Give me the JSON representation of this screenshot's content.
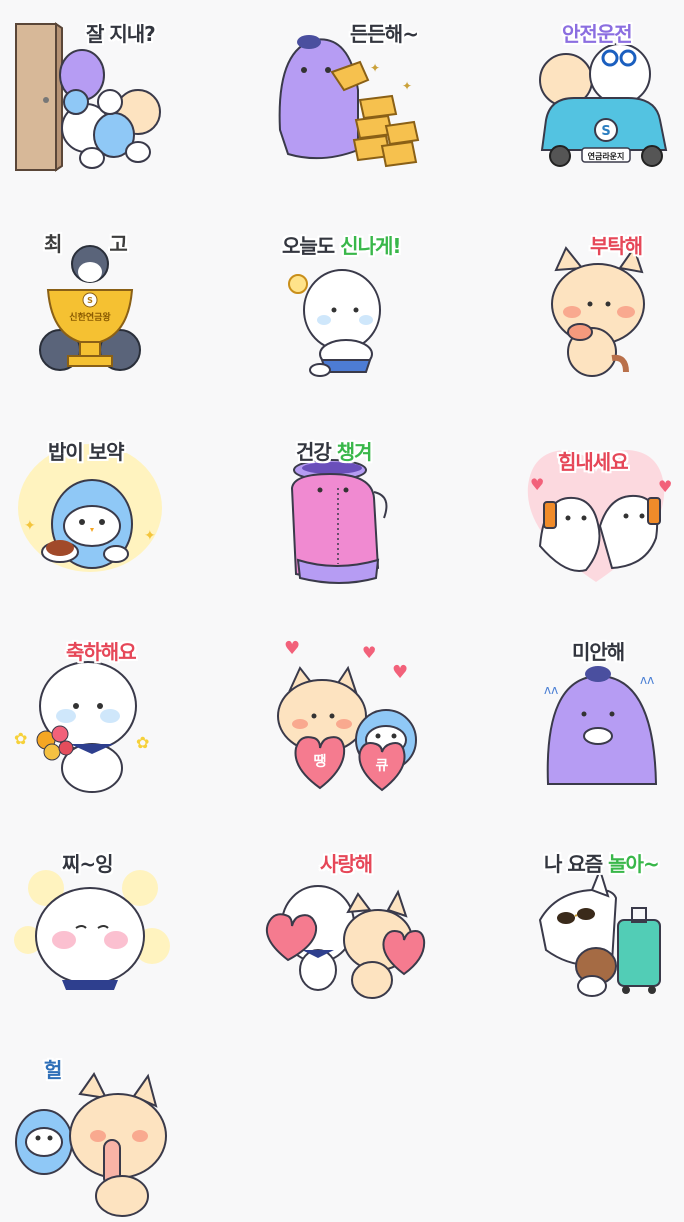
{
  "colors": {
    "background": "#f8f8f9",
    "purple": "#b69cf3",
    "blue": "#8fc8f6",
    "cream": "#fde3c0",
    "white": "#ffffff",
    "pink": "#f78fa5",
    "teal": "#52cdb6",
    "yellow": "#fff3bf"
  },
  "stickers": [
    {
      "caption_a": "잘 지내?",
      "caption_b": "",
      "icon": "door-friends-icon"
    },
    {
      "caption_a": "든든해~",
      "caption_b": "",
      "icon": "gold-bars-icon"
    },
    {
      "caption_a": "안전운전",
      "caption_b": "",
      "icon": "car-icon"
    },
    {
      "caption_a": "최",
      "caption_b": "고",
      "icon": "trophy-icon"
    },
    {
      "caption_a": "오늘도 ",
      "caption_b": "신나게!",
      "icon": "bear-dance-icon"
    },
    {
      "caption_a": "부탁해",
      "caption_b": "",
      "icon": "cat-plead-icon"
    },
    {
      "caption_a": "밥이 보약",
      "caption_b": "",
      "icon": "owl-rice-icon"
    },
    {
      "caption_a": "건강 ",
      "caption_b": "챙겨",
      "icon": "purple-jacket-icon"
    },
    {
      "caption_a": "힘내세요",
      "caption_b": "",
      "icon": "seals-drink-icon"
    },
    {
      "caption_a": "축하해요",
      "caption_b": "",
      "icon": "bear-bouquet-icon"
    },
    {
      "caption_a": "",
      "caption_b": "",
      "icon": "heart-balloons-icon",
      "heart_left": "땡",
      "heart_right": "큐"
    },
    {
      "caption_a": "미안해",
      "caption_b": "",
      "icon": "purple-sorry-icon"
    },
    {
      "caption_a": "찌~잉",
      "caption_b": "",
      "icon": "bear-blush-icon"
    },
    {
      "caption_a": "사랑해",
      "caption_b": "",
      "icon": "love-hearts-icon"
    },
    {
      "caption_a": "나 요즘 ",
      "caption_b": "놀아~",
      "icon": "cat-travel-icon"
    },
    {
      "caption_a": "헐",
      "caption_b": "",
      "icon": "owl-cat-shock-icon"
    }
  ],
  "car_plate": "연금라운지",
  "trophy_text": "신한연금왕",
  "logo_letter": "S"
}
